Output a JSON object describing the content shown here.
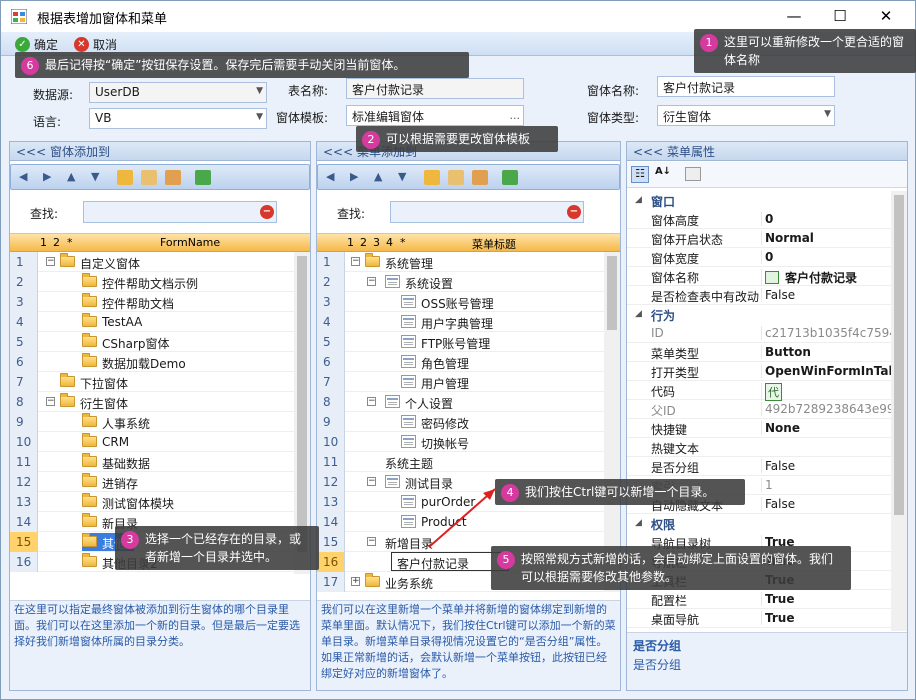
{
  "window": {
    "title": "根据表增加窗体和菜单",
    "min_glyph": "—",
    "max_glyph": "☐",
    "close_glyph": "✕"
  },
  "toolbar": {
    "ok_label": "确定",
    "cancel_label": "取消"
  },
  "form": {
    "datasource_label": "数据源:",
    "datasource_value": "UserDB",
    "language_label": "语言:",
    "language_value": "VB",
    "table_label": "表名称:",
    "table_value": "客户付款记录",
    "template_label": "窗体模板:",
    "template_value": "标准编辑窗体",
    "template_btn": "...",
    "formname_label": "窗体名称:",
    "formname_value": "客户付款记录",
    "formtype_label": "窗体类型:",
    "formtype_value": "衍生窗体"
  },
  "left_panel": {
    "header": "<<< 窗体添加到",
    "find_label": "查找:",
    "col_levels": [
      "1",
      "2",
      "*"
    ],
    "col_title": "FormName",
    "rows": [
      {
        "n": "1",
        "label": "自定义窗体",
        "depth": 0,
        "exp": "−"
      },
      {
        "n": "2",
        "label": "控件帮助文档示例",
        "depth": 1
      },
      {
        "n": "3",
        "label": "控件帮助文档",
        "depth": 1
      },
      {
        "n": "4",
        "label": "TestAA",
        "depth": 1
      },
      {
        "n": "5",
        "label": "CSharp窗体",
        "depth": 1
      },
      {
        "n": "6",
        "label": "数据加载Demo",
        "depth": 1
      },
      {
        "n": "7",
        "label": "下拉窗体",
        "depth": 0
      },
      {
        "n": "8",
        "label": "衍生窗体",
        "depth": 0,
        "exp": "−"
      },
      {
        "n": "9",
        "label": "人事系统",
        "depth": 1
      },
      {
        "n": "10",
        "label": "CRM",
        "depth": 1
      },
      {
        "n": "11",
        "label": "基础数据",
        "depth": 1
      },
      {
        "n": "12",
        "label": "进销存",
        "depth": 1
      },
      {
        "n": "13",
        "label": "测试窗体模块",
        "depth": 1
      },
      {
        "n": "14",
        "label": "新目录",
        "depth": 1
      },
      {
        "n": "15",
        "label": "其他",
        "depth": 1,
        "selected": true
      },
      {
        "n": "16",
        "label": "其他目录2",
        "depth": 1
      }
    ],
    "footer": "在这里可以指定最终窗体被添加到衍生窗体的哪个目录里面。我们可以在这里添加一个新的目录。但是最后一定要选择好我们新增窗体所属的目录分类。"
  },
  "mid_panel": {
    "header": "<<< 菜单添加到",
    "find_label": "查找:",
    "col_levels": [
      "1",
      "2",
      "3",
      "4",
      "*"
    ],
    "col_title": "菜单标题",
    "rows": [
      {
        "n": "1",
        "label": "系统管理",
        "depth": 0,
        "type": "folder",
        "exp": "−"
      },
      {
        "n": "2",
        "label": "系统设置",
        "depth": 1,
        "type": "doc",
        "exp": "−"
      },
      {
        "n": "3",
        "label": "OSS账号管理",
        "depth": 2,
        "type": "doc"
      },
      {
        "n": "4",
        "label": "用户字典管理",
        "depth": 2,
        "type": "doc"
      },
      {
        "n": "5",
        "label": "FTP账号管理",
        "depth": 2,
        "type": "doc"
      },
      {
        "n": "6",
        "label": "角色管理",
        "depth": 2,
        "type": "doc"
      },
      {
        "n": "7",
        "label": "用户管理",
        "depth": 2,
        "type": "doc"
      },
      {
        "n": "8",
        "label": "个人设置",
        "depth": 1,
        "type": "doc",
        "exp": "−"
      },
      {
        "n": "9",
        "label": "密码修改",
        "depth": 2,
        "type": "doc"
      },
      {
        "n": "10",
        "label": "切换帐号",
        "depth": 2,
        "type": "doc"
      },
      {
        "n": "11",
        "label": "系统主题",
        "depth": 1,
        "type": "none"
      },
      {
        "n": "12",
        "label": "测试目录",
        "depth": 1,
        "type": "doc",
        "exp": "−"
      },
      {
        "n": "13",
        "label": "purOrder",
        "depth": 2,
        "type": "doc"
      },
      {
        "n": "14",
        "label": "Product",
        "depth": 2,
        "type": "doc"
      },
      {
        "n": "15",
        "label": "新增目录",
        "depth": 1,
        "type": "none",
        "exp": "−"
      },
      {
        "n": "16",
        "label": "客户付款记录",
        "depth": 2,
        "type": "edit"
      },
      {
        "n": "17",
        "label": "业务系统",
        "depth": 0,
        "type": "folder",
        "exp": "+"
      }
    ],
    "footer": "我们可以在这里新增一个菜单并将新增的窗体绑定到新增的菜单里面。默认情况下，我们按住Ctrl键可以添加一个新的菜单目录。新增菜单目录得视情况设置它的“是否分组”属性。如果正常新增的话，会默认新增一个菜单按钮，此按钮已经绑定好对应的新增窗体了。"
  },
  "right_panel": {
    "header": "<<< 菜单属性",
    "sections": [
      {
        "name": "窗口",
        "props": [
          {
            "k": "窗体高度",
            "v": "0",
            "bold": true
          },
          {
            "k": "窗体开启状态",
            "v": "Normal",
            "bold": true
          },
          {
            "k": "窗体宽度",
            "v": "0",
            "bold": true
          },
          {
            "k": "窗体名称",
            "v": "客户付款记录",
            "bold": true,
            "icon": true
          },
          {
            "k": "是否检查表中有改动",
            "v": "False"
          }
        ]
      },
      {
        "name": "行为",
        "props": [
          {
            "k": "ID",
            "v": "c21713b1035f4c75947",
            "gray": true
          },
          {
            "k": "菜单类型",
            "v": "Button",
            "bold": true
          },
          {
            "k": "打开类型",
            "v": "OpenWinFormInTabl",
            "bold": true
          },
          {
            "k": "代码",
            "v": "代",
            "codebox": true
          },
          {
            "k": "父ID",
            "v": "492b7289238643e998",
            "gray": true
          },
          {
            "k": "快捷键",
            "v": "None",
            "bold": true
          },
          {
            "k": "热键文本",
            "v": ""
          },
          {
            "k": "是否分组",
            "v": "False"
          },
          {
            "k": "索引",
            "v": "1",
            "gray": true
          },
          {
            "k": "自动隐藏文本",
            "v": "False"
          }
        ]
      },
      {
        "name": "权限",
        "props": [
          {
            "k": "导航目录树",
            "v": "True",
            "bold": true
          },
          {
            "k": "导航栏",
            "v": "True",
            "bold": true
          },
          {
            "k": "工具栏",
            "v": "True",
            "bold": true
          },
          {
            "k": "配置栏",
            "v": "True",
            "bold": true
          },
          {
            "k": "桌面导航",
            "v": "True",
            "bold": true
          }
        ]
      }
    ],
    "desc_title": "是否分组",
    "desc_text": "是否分组"
  },
  "callouts": [
    {
      "n": "1",
      "text": "这里可以重新修改一个更合适的窗体名称"
    },
    {
      "n": "2",
      "text": "可以根据需要更改窗体模板"
    },
    {
      "n": "3",
      "text": "选择一个已经存在的目录，或者新增一个目录并选中。"
    },
    {
      "n": "4",
      "text": "我们按住Ctrl键可以新增一个目录。"
    },
    {
      "n": "5",
      "text": "按照常规方式新增的话，会自动绑定上面设置的窗体。我们可以根据需要修改其他参数。"
    },
    {
      "n": "6",
      "text": "最后记得按“确定”按钮保存设置。保存完后需要手动关闭当前窗体。"
    }
  ],
  "colors": {
    "accent": "#3a7de0",
    "badge": "#d63a9e",
    "header_orange": "#f5b94a"
  }
}
